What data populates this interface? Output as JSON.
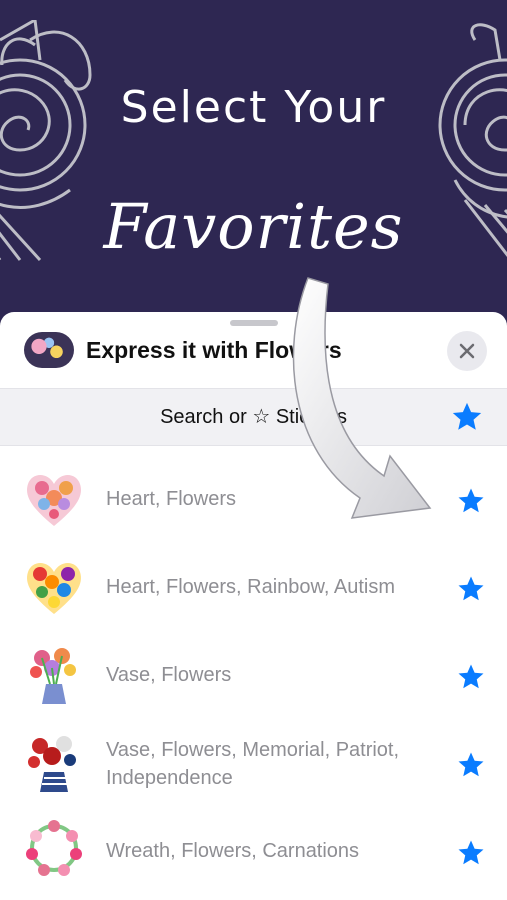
{
  "hero": {
    "title_line1": "Select Your",
    "title_line2": "Favorites"
  },
  "sheet": {
    "app_title": "Express it with Flowers",
    "search_label": "Search or ☆ Stickers"
  },
  "stickers": [
    {
      "label": "Heart, Flowers",
      "favorited": true
    },
    {
      "label": "Heart, Flowers, Rainbow, Autism",
      "favorited": true
    },
    {
      "label": "Vase, Flowers",
      "favorited": true
    },
    {
      "label": "Vase, Flowers, Memorial, Patriot, Independence",
      "favorited": true
    },
    {
      "label": "Wreath, Flowers, Carnations",
      "favorited": true
    }
  ],
  "colors": {
    "hero_bg": "#2e2752",
    "star_blue": "#0a7cff",
    "label_gray": "#8e8e93"
  }
}
